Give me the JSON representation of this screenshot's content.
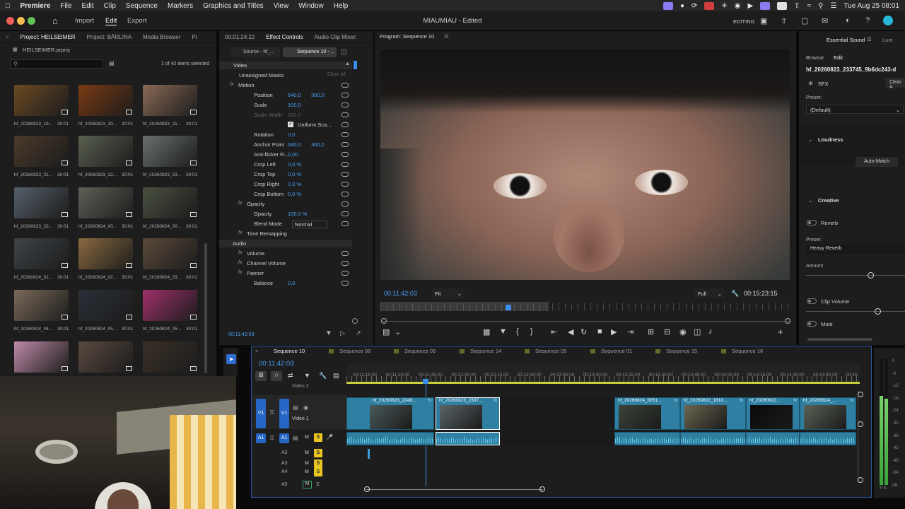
{
  "menubar": {
    "app": "Premiere",
    "items": [
      "File",
      "Edit",
      "Clip",
      "Sequence",
      "Markers",
      "Graphics and Titles",
      "View",
      "Window",
      "Help"
    ],
    "datetime": "Tue Aug 25  08:01"
  },
  "titlebar": {
    "nav": [
      "Import",
      "Edit",
      "Export"
    ],
    "title": "MIAUMIAU - Edited",
    "workspace": "EDITING"
  },
  "project": {
    "tabs": [
      "Project: HEILSEIMER",
      "Project: BÄRLINA",
      "Media Browser",
      "Pr"
    ],
    "file": "HEILSEIMER.prproj",
    "selection": "1 of 42 items selected",
    "items": [
      {
        "name": "hf_20260823_19...",
        "dur": "30:01",
        "color": "#6b4a22"
      },
      {
        "name": "hf_20260823_20...",
        "dur": "30:01",
        "color": "#7a3a12"
      },
      {
        "name": "hf_20260823_21...",
        "dur": "30:01",
        "color": "#8a6a55"
      },
      {
        "name": "hf_20260823_21...",
        "dur": "30:01",
        "color": "#4a3a2a"
      },
      {
        "name": "hf_20260823_22...",
        "dur": "30:01",
        "color": "#5a6050"
      },
      {
        "name": "hf_20260823_23...",
        "dur": "30:01",
        "color": "#6a7070"
      },
      {
        "name": "hf_20260823_23...",
        "dur": "30:01",
        "color": "#55606a"
      },
      {
        "name": "hf_20260824_00...",
        "dur": "30:01",
        "color": "#606058"
      },
      {
        "name": "hf_20260824_00...",
        "dur": "30:01",
        "color": "#4a5040"
      },
      {
        "name": "hf_20260824_01...",
        "dur": "30:01",
        "color": "#3e4448"
      },
      {
        "name": "hf_20260824_02...",
        "dur": "30:01",
        "color": "#8a6a40"
      },
      {
        "name": "hf_20260824_03...",
        "dur": "30:01",
        "color": "#5a4a3a"
      },
      {
        "name": "hf_20260824_04...",
        "dur": "30:01",
        "color": "#7a6a5a"
      },
      {
        "name": "hf_20260824_05...",
        "dur": "30:01",
        "color": "#2a3038"
      },
      {
        "name": "hf_20260824_05...",
        "dur": "30:01",
        "color": "#a0306a"
      },
      {
        "name": "",
        "dur": "",
        "color": "#c08aa8"
      },
      {
        "name": "",
        "dur": "",
        "color": "#5a4a40"
      },
      {
        "name": "",
        "dur": "",
        "color": "#3a3028"
      }
    ]
  },
  "effects": {
    "tabs": [
      "00:01:24:22",
      "Effect Controls",
      "Audio Clip Mixer:"
    ],
    "source": "Source - hf_...",
    "seq": "Sequence 10 - ...",
    "section_video": "Video",
    "masks": "Unassigned Masks",
    "clear_all": "Clear all",
    "rows": [
      {
        "label": "Motion",
        "v1": "",
        "v2": ""
      },
      {
        "label": "Position",
        "v1": "640,0",
        "v2": "360,0"
      },
      {
        "label": "Scale",
        "v1": "100,0",
        "v2": ""
      },
      {
        "label": "Scale Width",
        "v1": "100,0",
        "v2": ""
      },
      {
        "label": "Uniform Sca...",
        "v1": "",
        "v2": ""
      },
      {
        "label": "Rotation",
        "v1": "0,0",
        "v2": ""
      },
      {
        "label": "Anchor Point",
        "v1": "640,0",
        "v2": "360,0"
      },
      {
        "label": "Anti-flicker Fi...",
        "v1": "0,00",
        "v2": ""
      },
      {
        "label": "Crop Left",
        "v1": "0,0 %",
        "v2": ""
      },
      {
        "label": "Crop Top",
        "v1": "0,0 %",
        "v2": ""
      },
      {
        "label": "Crop Right",
        "v1": "0,0 %",
        "v2": ""
      },
      {
        "label": "Crop Bottom",
        "v1": "0,0 %",
        "v2": ""
      },
      {
        "label": "Opacity",
        "v1": "",
        "v2": ""
      },
      {
        "label": "Opacity",
        "v1": "100,0 %",
        "v2": ""
      },
      {
        "label": "Blend Mode",
        "v1": "Normal",
        "v2": ""
      },
      {
        "label": "Time Remapping",
        "v1": "",
        "v2": ""
      },
      {
        "label": "Audio",
        "v1": "",
        "v2": ""
      },
      {
        "label": "Volume",
        "v1": "",
        "v2": ""
      },
      {
        "label": "Channel Volume",
        "v1": "",
        "v2": ""
      },
      {
        "label": "Panner",
        "v1": "",
        "v2": ""
      },
      {
        "label": "Balance",
        "v1": "0,0",
        "v2": ""
      }
    ],
    "timecode": "00:11:42:03"
  },
  "program": {
    "tab": "Program: Sequence 10",
    "timecode": "00:11:42:03",
    "fit": "Fit",
    "quality": "Full",
    "duration": "00:15:23:15"
  },
  "essential": {
    "tabs": [
      "Essential Sound",
      "Lum"
    ],
    "browse": "Browse",
    "edit": "Edit",
    "clip": "hf_20260823_233745_9b6dc243-d",
    "sfx": "SFX",
    "clear": "Clear A",
    "preset_label": "Preset:",
    "preset_value": "(Default)",
    "loudness": "Loudness",
    "auto_match": "Auto-Match",
    "creative": "Creative",
    "reverb": "Reverb",
    "reverb_preset_label": "Preset:",
    "reverb_preset": "Heavy Reverb",
    "amount": "Amount",
    "clip_volume": "Clip Volume",
    "mute": "Mute"
  },
  "timeline": {
    "tabs": [
      "Sequence 10",
      "Sequence 08",
      "Sequence 09",
      "Sequence 14",
      "Sequence 05",
      "Sequence 01",
      "Sequence 15",
      "Sequence 16"
    ],
    "timecode": "00:11:42:03",
    "ticks": [
      "00:11:15:00",
      "00:11:30:00",
      "00:11:45:00",
      "00:12:00:00",
      "00:12:15:00",
      "00:12:30:00",
      "00:12:45:00",
      "00:13:00:00",
      "00:13:15:00",
      "00:13:30:00",
      "00:13:45:00",
      "00:14:00:00",
      "00:14:15:00",
      "00:14:30:00",
      "00:14:45:00",
      "00:15"
    ],
    "video2": "Video 2",
    "video1": "Video 1",
    "clips": [
      "hf_20260823_2248...",
      "hf_20260823_2337...",
      "hf_20260824_0051...",
      "hf_20260822_1810...",
      "hf_20260822...",
      "hf_20260824_..."
    ],
    "tracks": [
      "V1",
      "V1",
      "A1",
      "A1",
      "A2",
      "A3",
      "A4",
      "A5"
    ],
    "m": "M",
    "s": "S"
  },
  "meter": {
    "labels": [
      "0",
      "-6",
      "-12",
      "-18",
      "-24",
      "-30",
      "-36",
      "-42",
      "-48",
      "-54",
      "dB"
    ],
    "footer": "S S"
  }
}
